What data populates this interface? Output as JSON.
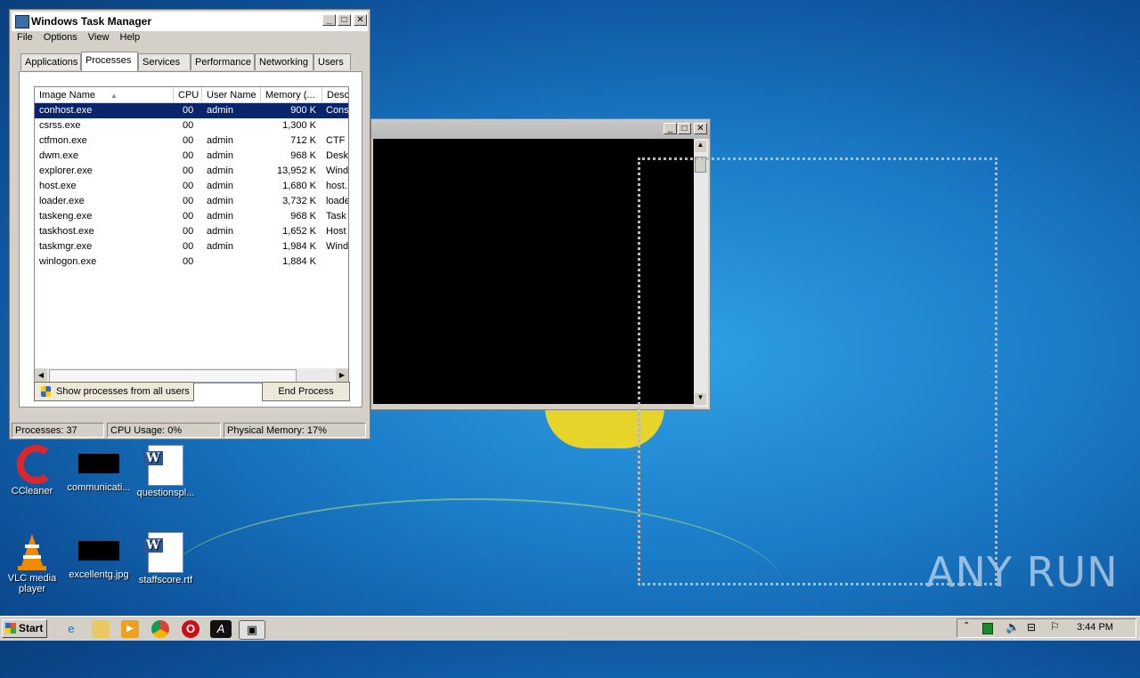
{
  "desktop": {
    "icons": [
      {
        "label": "CCleaner"
      },
      {
        "label": "communicati..."
      },
      {
        "label": "questionspl..."
      },
      {
        "label": "VLC media player"
      },
      {
        "label": "excellentg.jpg"
      },
      {
        "label": "staffscore.rtf"
      }
    ],
    "watermark": "ANY RUN"
  },
  "task_manager": {
    "title": "Windows Task Manager",
    "menu": [
      "File",
      "Options",
      "View",
      "Help"
    ],
    "tabs": [
      "Applications",
      "Processes",
      "Services",
      "Performance",
      "Networking",
      "Users"
    ],
    "active_tab": "Processes",
    "columns": [
      "Image Name",
      "CPU",
      "User Name",
      "Memory (...",
      "Desc"
    ],
    "rows": [
      {
        "name": "conhost.exe",
        "cpu": "00",
        "user": "admin",
        "mem": "900 K",
        "desc": "Cons"
      },
      {
        "name": "csrss.exe",
        "cpu": "00",
        "user": "",
        "mem": "1,300 K",
        "desc": ""
      },
      {
        "name": "ctfmon.exe",
        "cpu": "00",
        "user": "admin",
        "mem": "712 K",
        "desc": "CTF l"
      },
      {
        "name": "dwm.exe",
        "cpu": "00",
        "user": "admin",
        "mem": "968 K",
        "desc": "Desk"
      },
      {
        "name": "explorer.exe",
        "cpu": "00",
        "user": "admin",
        "mem": "13,952 K",
        "desc": "Wind"
      },
      {
        "name": "host.exe",
        "cpu": "00",
        "user": "admin",
        "mem": "1,680 K",
        "desc": "host."
      },
      {
        "name": "loader.exe",
        "cpu": "00",
        "user": "admin",
        "mem": "3,732 K",
        "desc": "loade"
      },
      {
        "name": "taskeng.exe",
        "cpu": "00",
        "user": "admin",
        "mem": "968 K",
        "desc": "Task"
      },
      {
        "name": "taskhost.exe",
        "cpu": "00",
        "user": "admin",
        "mem": "1,652 K",
        "desc": "Host"
      },
      {
        "name": "taskmgr.exe",
        "cpu": "00",
        "user": "admin",
        "mem": "1,984 K",
        "desc": "Wind"
      },
      {
        "name": "winlogon.exe",
        "cpu": "00",
        "user": "",
        "mem": "1,884 K",
        "desc": ""
      }
    ],
    "show_all_label": "Show processes from all users",
    "end_process_label": "End Process",
    "status": {
      "processes": "Processes: 37",
      "cpu": "CPU Usage: 0%",
      "memory": "Physical Memory: 17%"
    }
  },
  "taskbar": {
    "start_label": "Start",
    "clock": "3:44 PM"
  }
}
